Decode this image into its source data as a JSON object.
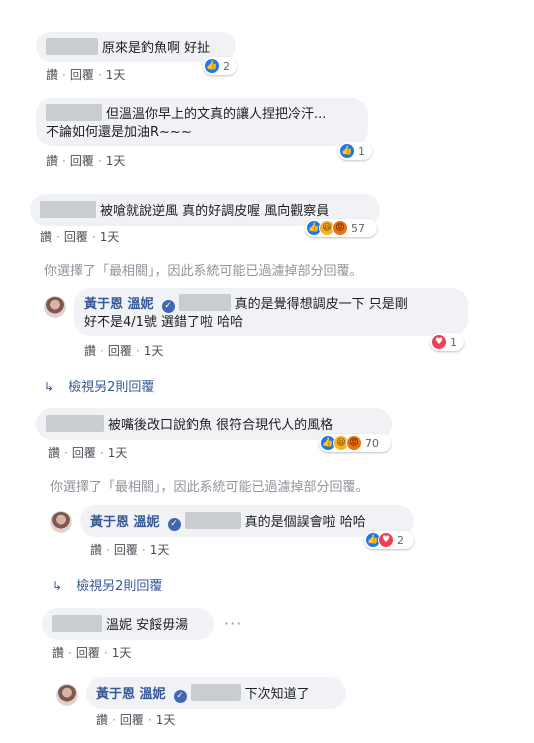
{
  "actions": {
    "like": "讚",
    "reply": "回覆",
    "time": "1天",
    "sep": "·"
  },
  "notice_text": "你選擇了「最相關」，因此系統可能已過濾掉部分回覆。",
  "reply_author": "黃于恩 溫妮",
  "more_replies": "檢視另2則回覆",
  "comments": [
    {
      "text": "原來是釣魚啊 好扯",
      "reactions": "2"
    },
    {
      "text_line1": "但溫溫你早上的文真的讓人捏把冷汗...",
      "text_line2": "不論如何還是加油R~~~",
      "reactions": "1"
    },
    {
      "text": "被嗆就說逆風 真的好調皮喔 風向觀察員",
      "reactions": "57",
      "reply": {
        "text_line1": "真的是覺得想調皮一下 只是剛",
        "text_line2": "好不是4/1號 選錯了啦 哈哈",
        "reactions": "1"
      }
    },
    {
      "text": "被嘴後改口說釣魚 很符合現代人的風格",
      "reactions": "70",
      "reply": {
        "text": "真的是個誤會啦 哈哈",
        "reactions": "2"
      }
    },
    {
      "text": "溫妮 安餒毋湯",
      "more": "···",
      "reply": {
        "text": "下次知道了"
      }
    }
  ],
  "icons": {
    "like": "like-icon",
    "haha": "haha-icon",
    "angry": "angry-icon",
    "love": "love-icon",
    "verified": "verified-icon"
  }
}
